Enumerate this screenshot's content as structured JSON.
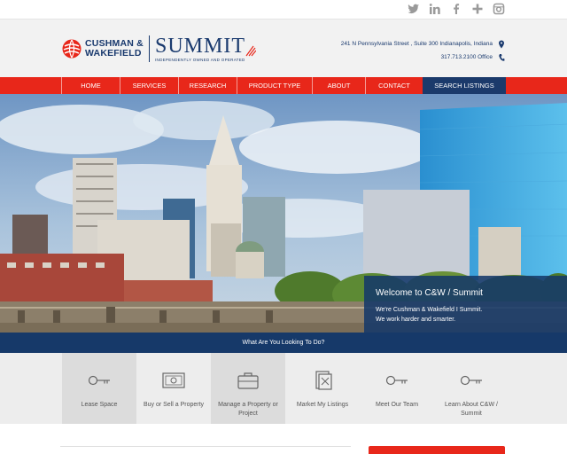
{
  "social": {
    "icons": [
      "twitter-icon",
      "linkedin-icon",
      "facebook-icon",
      "google-plus-icon",
      "instagram-icon"
    ]
  },
  "logo": {
    "cw_line1": "CUSHMAN &",
    "cw_line2": "WAKEFIELD",
    "summit": "SUMMIT",
    "tagline": "INDEPENDENTLY OWNED AND OPERATED"
  },
  "contact": {
    "address": "241 N Pennsylvania Street , Suite 300 Indianapolis, Indiana",
    "phone": "317.713.2100 Office"
  },
  "nav": {
    "items": [
      {
        "label": "HOME"
      },
      {
        "label": "SERVICES"
      },
      {
        "label": "RESEARCH"
      },
      {
        "label": "PRODUCT TYPE"
      },
      {
        "label": "ABOUT"
      },
      {
        "label": "CONTACT"
      },
      {
        "label": "SEARCH LISTINGS"
      }
    ]
  },
  "welcome": {
    "title": "Welcome to C&W / Summit",
    "line1": "We're Cushman & Wakefield I Summit.",
    "line2": "We work harder and smarter."
  },
  "what_bar": {
    "label": "What Are You Looking To Do?"
  },
  "services": {
    "tiles": [
      {
        "label": "Lease Space",
        "icon": "key-icon"
      },
      {
        "label": "Buy or Sell a Property",
        "icon": "money-icon"
      },
      {
        "label": "Manage a Property or Project",
        "icon": "briefcase-icon"
      },
      {
        "label": "Market My Listings",
        "icon": "documents-icon"
      },
      {
        "label": "Meet Our Team",
        "icon": "key-icon"
      },
      {
        "label": "Learn About C&W / Summit",
        "icon": "key-icon"
      }
    ]
  },
  "colors": {
    "accent_red": "#e8271a",
    "brand_navy": "#163969"
  }
}
